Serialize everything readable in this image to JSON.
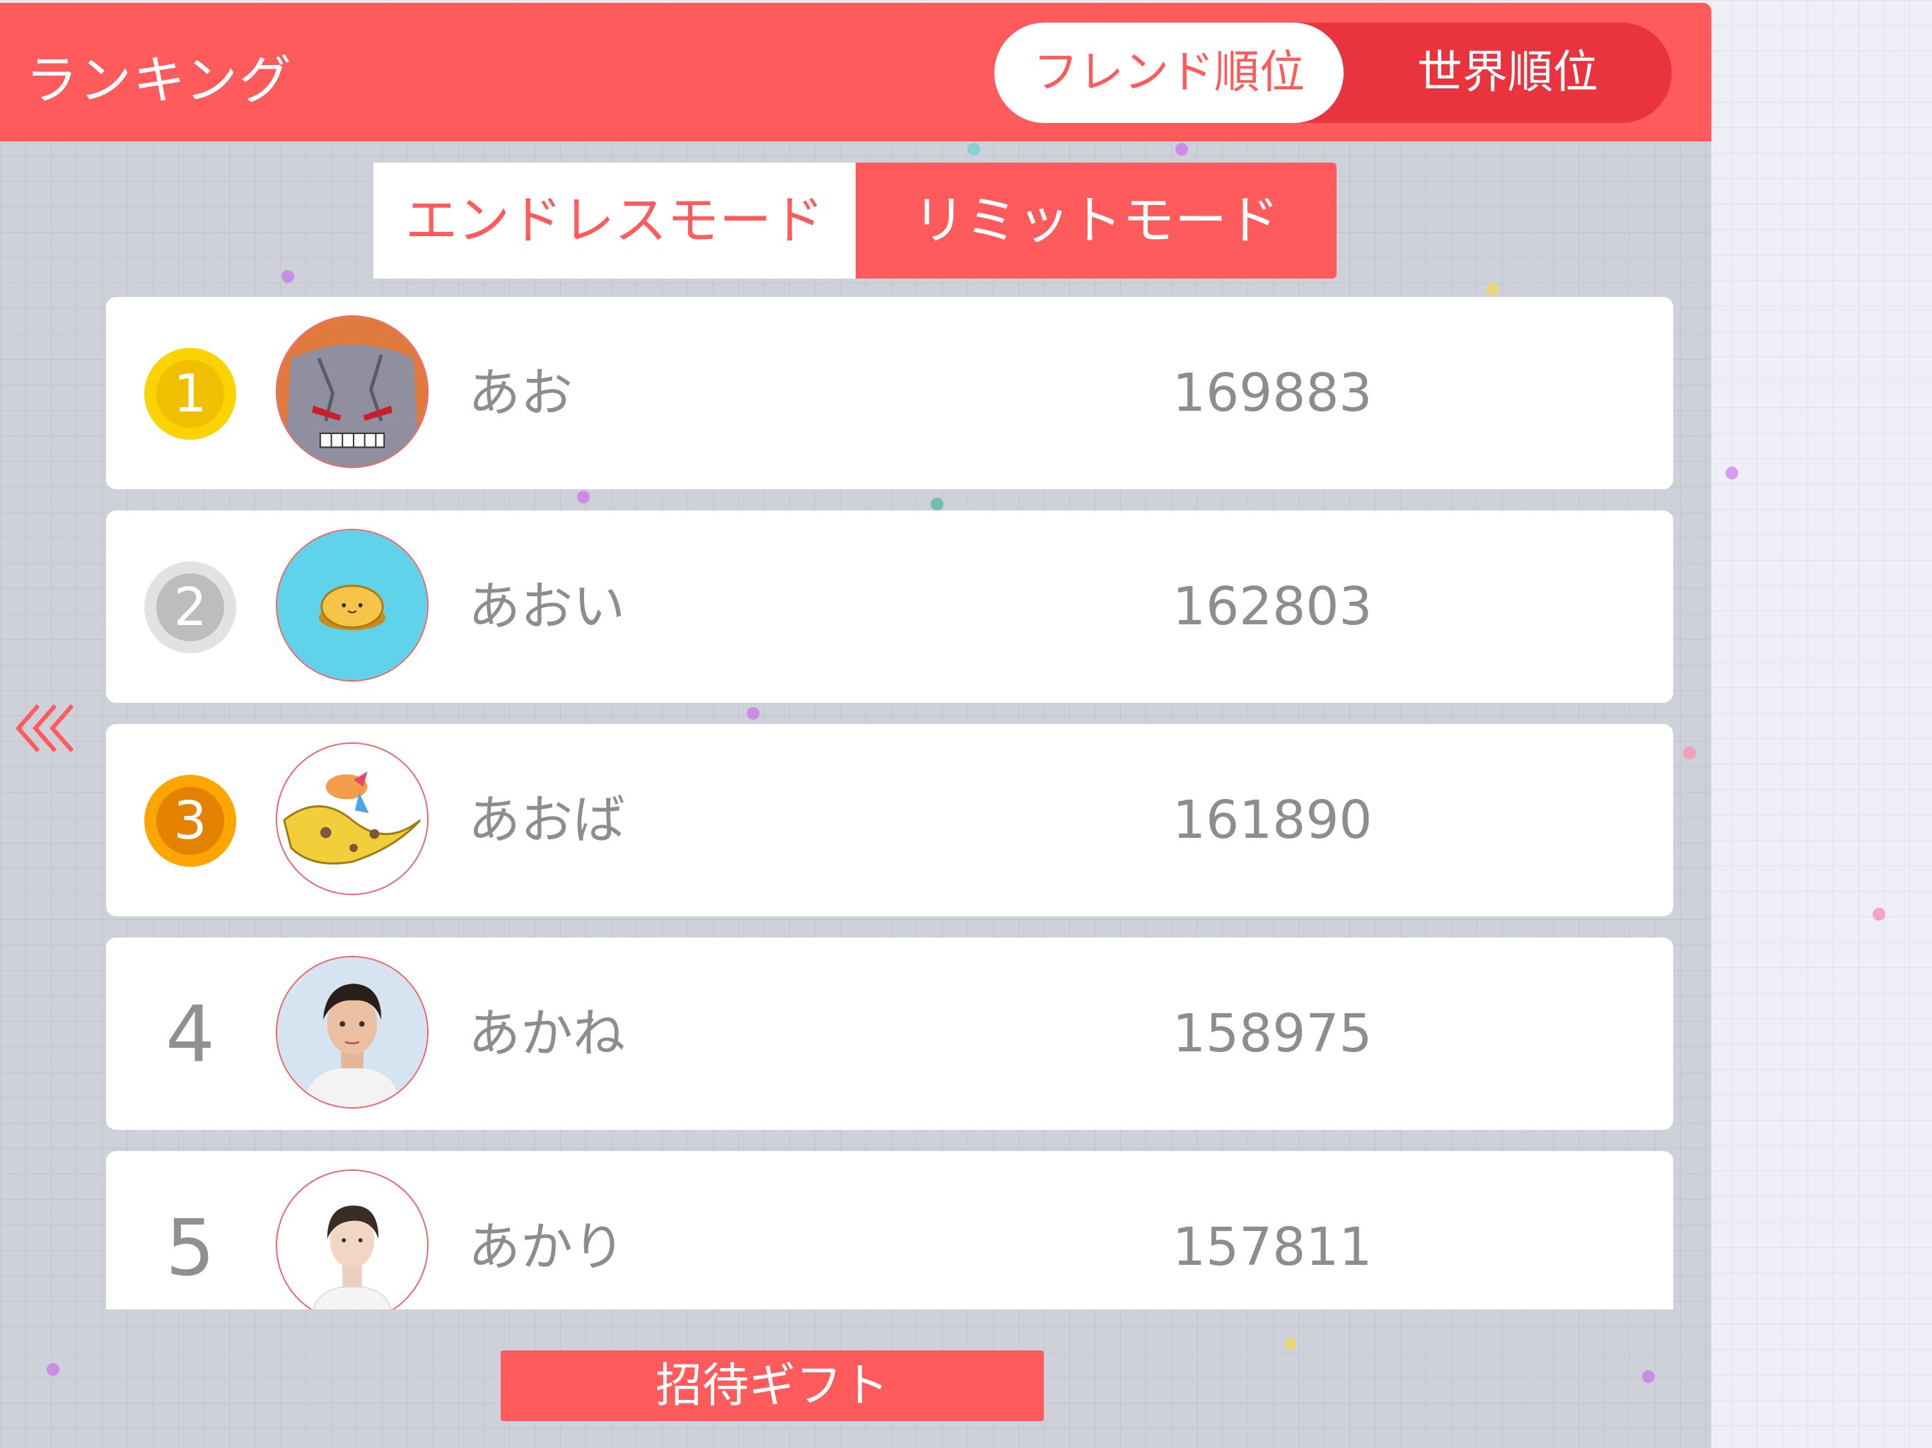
{
  "header": {
    "title": "ランキング",
    "scope_tabs": [
      {
        "label": "フレンド順位",
        "selected": true
      },
      {
        "label": "世界順位",
        "selected": false
      }
    ]
  },
  "mode_tabs": [
    {
      "label": "エンドレスモード",
      "selected": false
    },
    {
      "label": "リミットモード",
      "selected": true
    }
  ],
  "rankings": [
    {
      "rank": "1",
      "name": "あお",
      "score": "169883"
    },
    {
      "rank": "2",
      "name": "あおい",
      "score": "162803"
    },
    {
      "rank": "3",
      "name": "あおば",
      "score": "161890"
    },
    {
      "rank": "4",
      "name": "あかね",
      "score": "158975"
    },
    {
      "rank": "5",
      "name": "あかり",
      "score": "157811"
    }
  ],
  "back_icon": "triple-chevron-left-icon",
  "gift_button_label": "招待ギフト",
  "colors": {
    "accent": "#ff5a5c",
    "accent_dark": "#e9343f",
    "gold": "#fbd400",
    "silver": "#e2e2e2",
    "bronze": "#ffa500",
    "text_muted": "#8d8d8d"
  }
}
